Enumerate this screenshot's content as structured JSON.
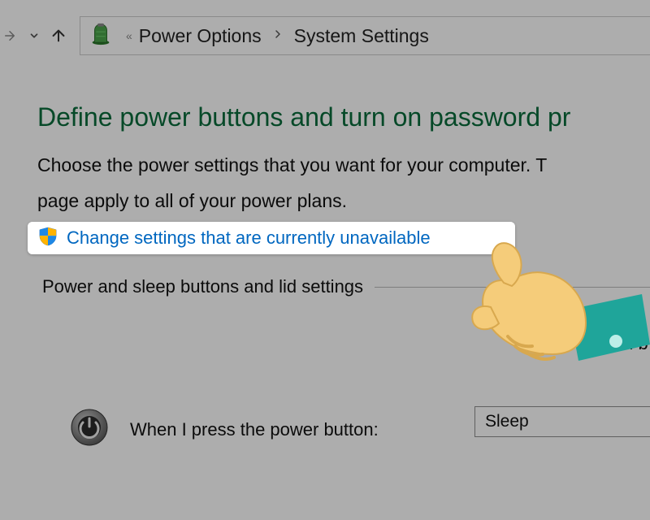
{
  "breadcrumb": {
    "prev_chevrons": "«",
    "item1": "Power Options",
    "item2": "System Settings"
  },
  "header": {
    "title": "Define power buttons and turn on password pr",
    "lead1": "Choose the power settings that you want for your computer. T",
    "lead2": "page apply to all of your power plans."
  },
  "unlock": {
    "label": "Change settings that are currently unavailable"
  },
  "section": {
    "heading": "Power and sleep buttons and lid settings",
    "on_label": "On b"
  },
  "options": {
    "power_button_label": "When I press the power button:",
    "power_button_value": "Sleep"
  }
}
